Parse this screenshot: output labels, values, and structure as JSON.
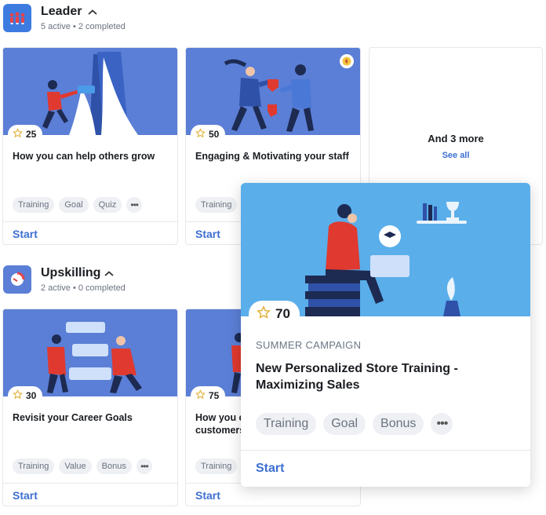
{
  "sections": [
    {
      "title": "Leader",
      "subtitle": "5 active • 2 completed"
    },
    {
      "title": "Upskilling",
      "subtitle": "2 active • 0 completed"
    }
  ],
  "leader_cards": [
    {
      "points": "25",
      "title": "How you can help others grow",
      "tags": [
        "Training",
        "Goal",
        "Quiz"
      ],
      "start": "Start"
    },
    {
      "points": "50",
      "title": "Engaging & Motivating your staff",
      "tags": [
        "Training"
      ],
      "start": "Start"
    }
  ],
  "more_card": {
    "label": "And 3 more",
    "link": "See all"
  },
  "upskilling_cards": [
    {
      "points": "30",
      "title": "Revisit your Career Goals",
      "tags": [
        "Training",
        "Value",
        "Bonus"
      ],
      "start": "Start"
    },
    {
      "points": "75",
      "title_line1": "How you c",
      "title_line2": "customers",
      "tags": [
        "Training"
      ],
      "start": "Start"
    }
  ],
  "popup": {
    "points": "70",
    "campaign": "SUMMER CAMPAIGN",
    "title": "New Personalized Store Training - Maximizing Sales",
    "tags": [
      "Training",
      "Goal",
      "Bonus"
    ],
    "start": "Start"
  },
  "more_glyph": "•••",
  "colors": {
    "accent": "#3d6fd3",
    "card_image": "#5b7fd6",
    "popup_image": "#5aaeea",
    "star": "#e2b23c"
  }
}
